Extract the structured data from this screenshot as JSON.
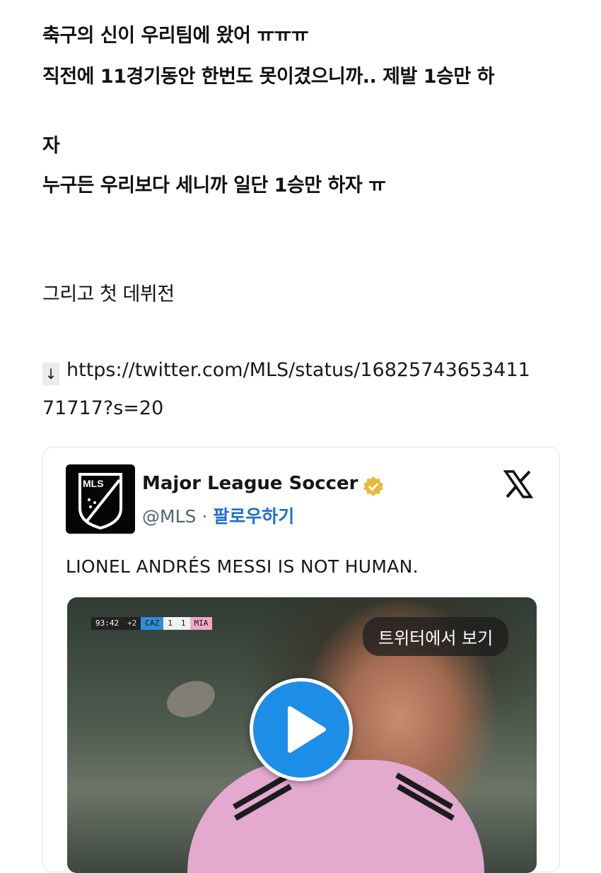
{
  "post": {
    "line1": "축구의 신이 우리팀에 왔어 ㅠㅠㅠ",
    "line2": "직전에 11경기동안 한번도 못이겼으니까.. 제발 1승만 하",
    "line3": "자",
    "line4": "누구든 우리보다 세니까 일단 1승만 하자 ㅠ",
    "line5": "그리고 첫 데뷔전",
    "arrow": "↓",
    "link_part1": "https://twitter.com/MLS/status/16825743653411",
    "link_part2": "71717?s=20"
  },
  "tweet": {
    "account_name": "Major League Soccer",
    "handle": "@MLS",
    "separator": " · ",
    "follow_label": "팔로우하기",
    "avatar_text": "MLS",
    "body": "LIONEL ANDRÉS MESSI IS NOT HUMAN.",
    "view_on_twitter": "트위터에서 보기",
    "scoreboard": {
      "time": "93:42",
      "added": "+2",
      "home": "CAZ",
      "home_score": "1",
      "away_score": "1",
      "away": "MIA"
    }
  },
  "colors": {
    "verified": "#e8b93a",
    "follow_link": "#1d6fcf",
    "play_button": "#1d8ee8",
    "jersey": "#e4a9cf"
  },
  "icons": [
    "verified-badge-icon",
    "x-logo-icon",
    "play-icon",
    "arrow-down-icon"
  ]
}
